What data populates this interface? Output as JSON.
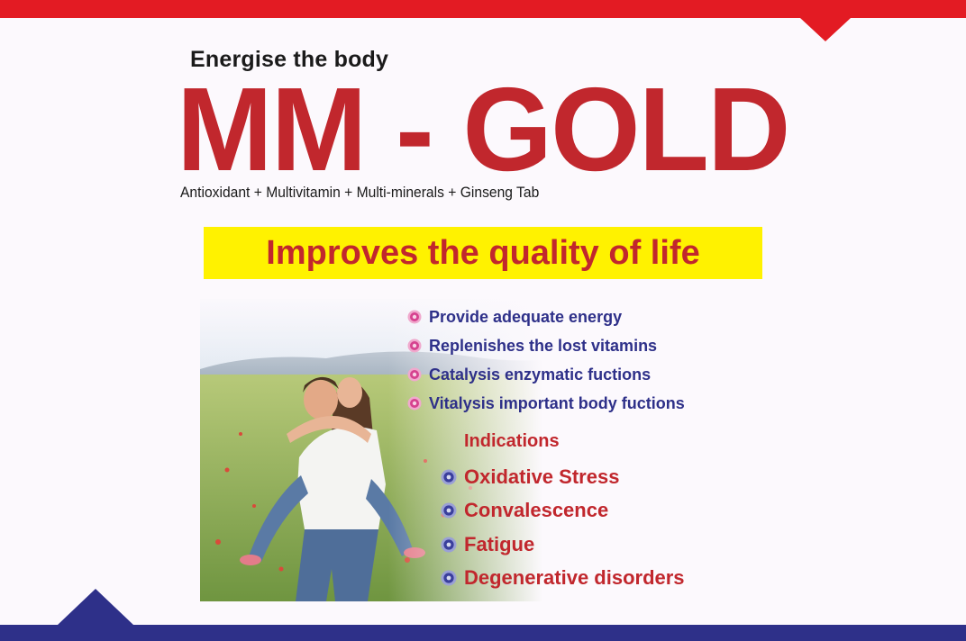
{
  "header": {
    "tagline": "Energise the body",
    "brand": "MM - GOLD",
    "composition": "Antioxidant + Multivitamin + Multi-minerals + Ginseng Tab"
  },
  "highlight": {
    "text": "Improves the quality of life"
  },
  "benefits": [
    "Provide adequate energy",
    "Replenishes the lost vitamins",
    "Catalysis enzymatic fuctions",
    "Vitalysis important body fuctions"
  ],
  "indications": {
    "heading": "Indications",
    "items": [
      "Oxidative Stress",
      "Convalescence",
      "Fatigue",
      "Degenerative disorders"
    ]
  },
  "colors": {
    "brand_red": "#c1272d",
    "top_bar_red": "#e31b23",
    "bottom_bar_blue": "#2e3089",
    "highlight_yellow": "#fff200",
    "benefit_text_navy": "#2e3089",
    "benefit_bullet_pink": "#d6428f",
    "indication_bullet_blue": "#3a3f9c"
  },
  "icons": {
    "benefit_bullet": "pink-flower-icon",
    "indication_bullet": "blue-flower-icon"
  }
}
